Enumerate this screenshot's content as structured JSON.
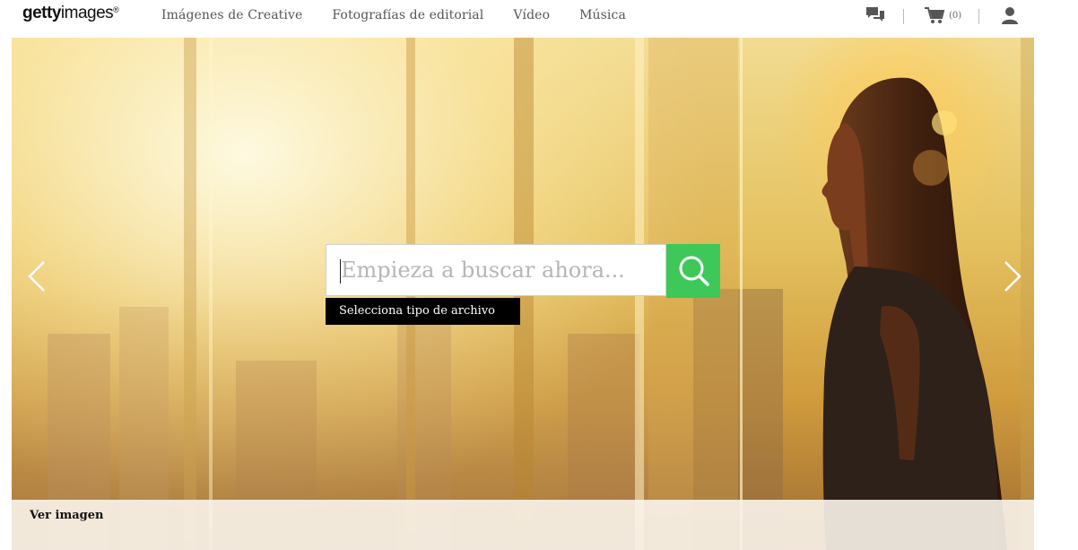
{
  "brand": {
    "logo_bold": "getty",
    "logo_regular": "images",
    "logo_mark": "®"
  },
  "nav": {
    "items": [
      {
        "label": "Imágenes de Creative"
      },
      {
        "label": "Fotografías de editorial"
      },
      {
        "label": "Vídeo"
      },
      {
        "label": "Música"
      }
    ]
  },
  "tools": {
    "chat_icon": "chat-bubbles-icon",
    "cart_icon": "shopping-cart-icon",
    "cart_count": "(0)",
    "account_icon": "user-account-icon"
  },
  "search": {
    "placeholder": "Empieza a buscar ahora...",
    "value": "",
    "button_icon": "search-icon",
    "file_type_label": "Selecciona tipo de archivo"
  },
  "hero": {
    "prev_icon": "chevron-left-icon",
    "next_icon": "chevron-right-icon",
    "credit_label": "Ver imagen"
  },
  "colors": {
    "search_button": "#3ec859",
    "file_type_bg": "#000000"
  }
}
